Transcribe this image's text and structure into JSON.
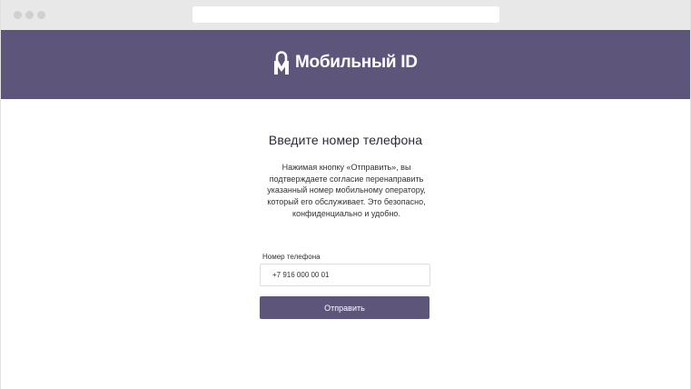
{
  "header": {
    "logo_text": "Мобильный ID",
    "background_color": "#5e557a"
  },
  "form": {
    "title": "Введите номер телефона",
    "description": "Нажимая кнопку «Отправить», вы подтверждаете согласие перенаправить указанный номер мобильному оператору, который его обслуживает. Это безопасно, конфиденциально и удобно.",
    "phone_label": "Номер телефона",
    "phone_value": "+7 916 000 00 01",
    "submit_label": "Отправить"
  }
}
